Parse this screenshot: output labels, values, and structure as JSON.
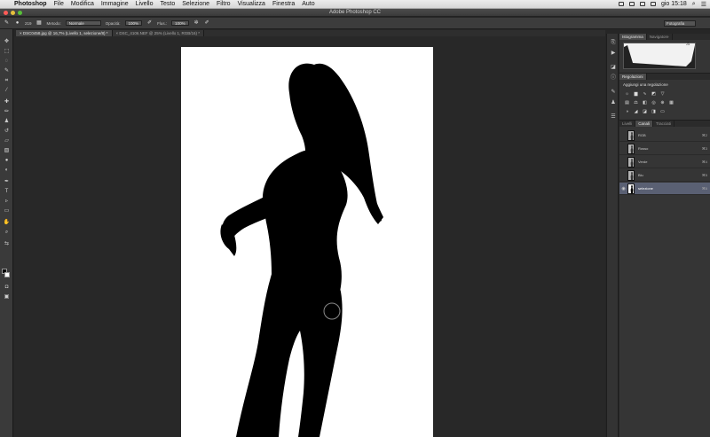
{
  "menubar": {
    "app_name": "Photoshop",
    "items": [
      "File",
      "Modifica",
      "Immagine",
      "Livello",
      "Testo",
      "Selezione",
      "Filtro",
      "Visualizza",
      "Finestra",
      "Auto"
    ],
    "clock": "gio 15:18"
  },
  "window": {
    "title": "Adobe Photoshop CC"
  },
  "options": {
    "brush_size": "219",
    "mode_label": "Metodo:",
    "mode_value": "Normale",
    "opacity_label": "Opacità:",
    "opacity_value": "100%",
    "flow_label": "Flus.:",
    "flow_value": "100%",
    "workspace": "Fotografia"
  },
  "tabs": [
    {
      "label": "DSC0458.jpg @ 16,7% (Livello 1, selezione/8) *",
      "active": true
    },
    {
      "label": "DSC_4106.NEF @ 25% (Livello 1, RGB/16) *",
      "active": false
    }
  ],
  "panels": {
    "histogram_tabs": [
      "Istogramma",
      "Navigatore"
    ],
    "adjustments_title": "Regolazioni",
    "adjustments_add": "Aggiungi una regolazione",
    "channels_tabs": [
      "Livelli",
      "Canali",
      "Tracciati"
    ],
    "channels": [
      {
        "name": "RGB",
        "key": "⌘2",
        "selected": false,
        "mask": false
      },
      {
        "name": "Rosso",
        "key": "⌘3",
        "selected": false,
        "mask": false
      },
      {
        "name": "Verde",
        "key": "⌘4",
        "selected": false,
        "mask": false
      },
      {
        "name": "Blu",
        "key": "⌘5",
        "selected": false,
        "mask": false
      },
      {
        "name": "selezione",
        "key": "⌘6",
        "selected": true,
        "mask": true
      }
    ]
  },
  "colors": {
    "accent_selected": "#5a6073",
    "panel": "#353535",
    "canvas": "#ffffff"
  }
}
